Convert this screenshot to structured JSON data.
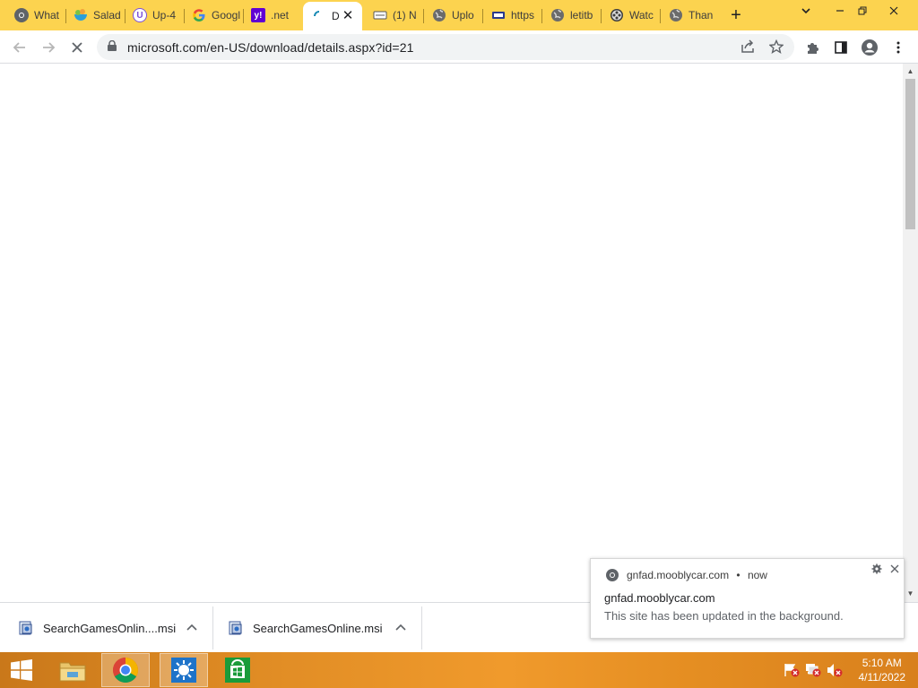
{
  "tabs": [
    {
      "title": "What",
      "favicon": "chrome-icon"
    },
    {
      "title": "Salad",
      "favicon": "salad-icon"
    },
    {
      "title": "Up-4",
      "favicon": "u-icon"
    },
    {
      "title": "Google",
      "favicon": "google-icon"
    },
    {
      "title": ".net",
      "favicon": "yahoo-icon"
    },
    {
      "title": "D",
      "favicon": "loading-spinner-icon",
      "active": true
    },
    {
      "title": "(1) N",
      "favicon": "page-icon"
    },
    {
      "title": "Uplo",
      "favicon": "globe-icon"
    },
    {
      "title": "https",
      "favicon": "site-icon"
    },
    {
      "title": "letitb",
      "favicon": "globe-icon"
    },
    {
      "title": "Watc",
      "favicon": "reel-icon"
    },
    {
      "title": "Than",
      "favicon": "globe-icon"
    }
  ],
  "toolbar": {
    "url": "microsoft.com/en-US/download/details.aspx?id=21"
  },
  "downloads": [
    {
      "name": "SearchGamesOnlin....msi"
    },
    {
      "name": "SearchGamesOnline.msi"
    }
  ],
  "notification": {
    "source": "gnfad.mooblycar.com",
    "time": "now",
    "separator": "•",
    "title": "gnfad.mooblycar.com",
    "body": "This site has been updated in the background."
  },
  "taskbar": {
    "time": "5:10 AM",
    "date": "4/11/2022"
  },
  "colors": {
    "tabstrip": "#fcd34f",
    "taskbar": "#e18d25"
  }
}
